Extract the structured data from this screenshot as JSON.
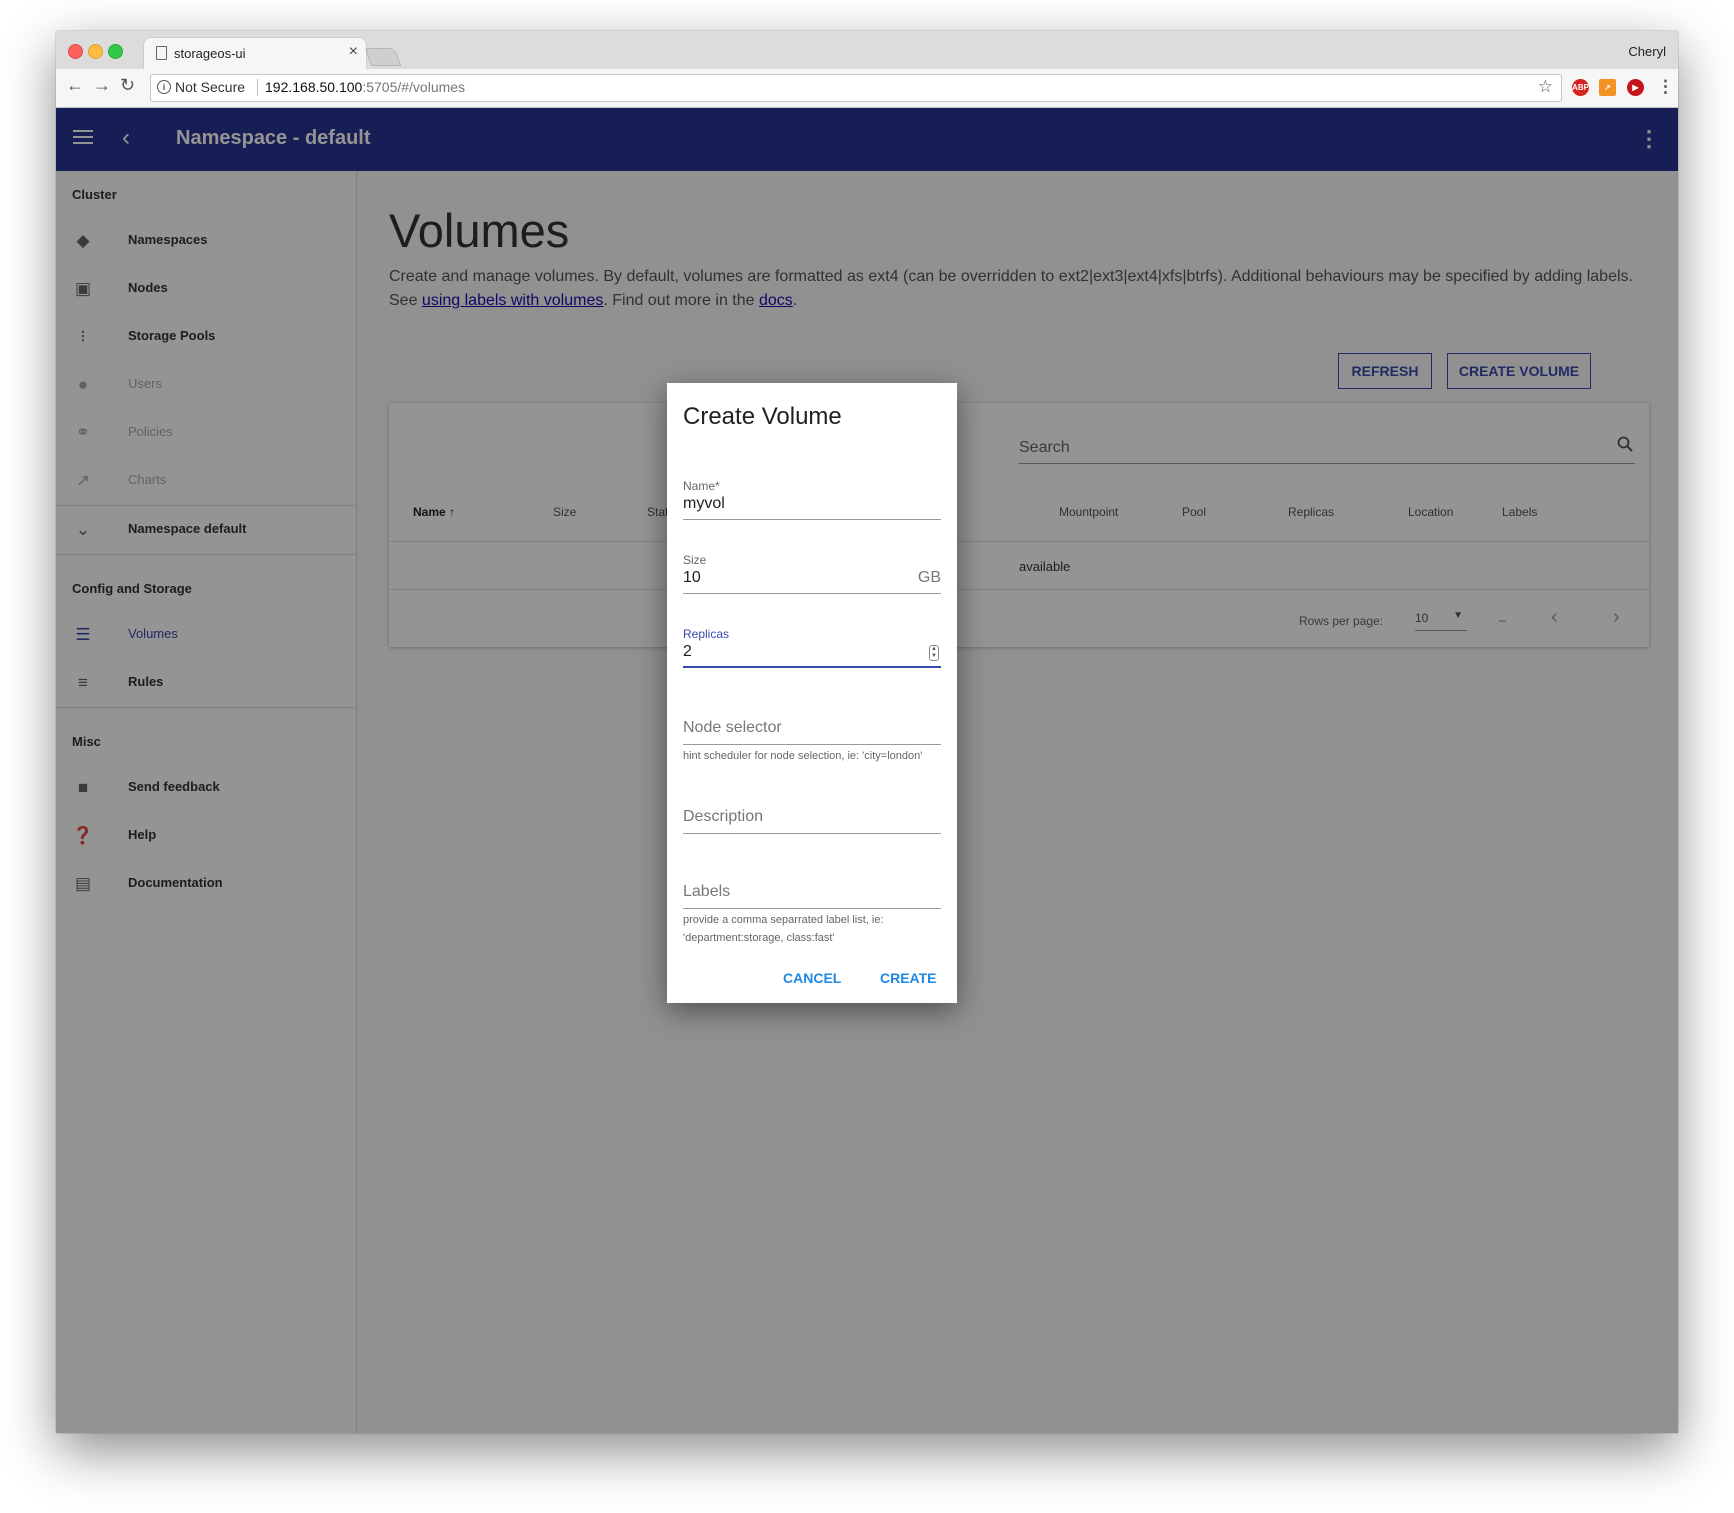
{
  "browser": {
    "tab_title": "storageos-ui",
    "tab_close": "×",
    "profile_name": "Cheryl",
    "security_label": "Not Secure",
    "url_host": "192.168.50.100",
    "url_rest": ":5705/#/volumes",
    "extensions": [
      "abp-icon",
      "chart-extension-icon",
      "play-extension-icon"
    ]
  },
  "appbar": {
    "title": "Namespace - default",
    "color": "#283593"
  },
  "sidebar": {
    "sections": {
      "cluster": "Cluster",
      "config": "Config and Storage",
      "misc": "Misc"
    },
    "items": [
      {
        "label": "Namespaces",
        "icon": "layers-icon",
        "state": "normal"
      },
      {
        "label": "Nodes",
        "icon": "chip-icon",
        "state": "normal"
      },
      {
        "label": "Storage Pools",
        "icon": "bubbles-icon",
        "state": "normal"
      },
      {
        "label": "Users",
        "icon": "people-icon",
        "state": "disabled"
      },
      {
        "label": "Policies",
        "icon": "key-icon",
        "state": "disabled"
      },
      {
        "label": "Charts",
        "icon": "chart-line-icon",
        "state": "disabled"
      },
      {
        "label": "Namespace default",
        "icon": "chevron-down-icon",
        "state": "normal"
      },
      {
        "label": "Volumes",
        "icon": "list-icon",
        "state": "active"
      },
      {
        "label": "Rules",
        "icon": "rules-icon",
        "state": "normal"
      },
      {
        "label": "Send feedback",
        "icon": "feedback-icon",
        "state": "normal"
      },
      {
        "label": "Help",
        "icon": "help-icon",
        "state": "normal"
      },
      {
        "label": "Documentation",
        "icon": "document-icon",
        "state": "normal"
      }
    ]
  },
  "main": {
    "title": "Volumes",
    "description_part1": "Create and manage volumes. By default, volumes are formatted as ext4 (can be overridden to ext2|ext3|ext4|xfs|btrfs). Additional behaviours may be specified by adding labels. See ",
    "description_link1": "using labels with volumes",
    "description_part2": ". Find out more in the ",
    "description_link2": "docs",
    "description_part3": ".",
    "refresh_label": "REFRESH",
    "create_volume_label": "CREATE VOLUME",
    "search_placeholder": "Search",
    "columns": [
      "Name",
      "Size",
      "Status",
      "Mountpoint",
      "Pool",
      "Replicas",
      "Location",
      "Labels"
    ],
    "sort_indicator": "↑",
    "empty_text": "available",
    "rows_per_page_label": "Rows per page:",
    "rows_per_page_value": "10",
    "range_text": "–"
  },
  "dialog": {
    "title": "Create Volume",
    "name_label": "Name*",
    "name_value": "myvol",
    "size_label": "Size",
    "size_value": "10",
    "size_unit": "GB",
    "replicas_label": "Replicas",
    "replicas_value": "2",
    "node_selector_placeholder": "Node selector",
    "node_selector_help": "hint scheduler for node selection, ie: 'city=london'",
    "description_placeholder": "Description",
    "labels_placeholder": "Labels",
    "labels_help": "provide a comma separrated label list, ie: 'department:storage, class:fast'",
    "cancel_label": "CANCEL",
    "create_label": "CREATE",
    "accent_color": "#1e88e5"
  }
}
